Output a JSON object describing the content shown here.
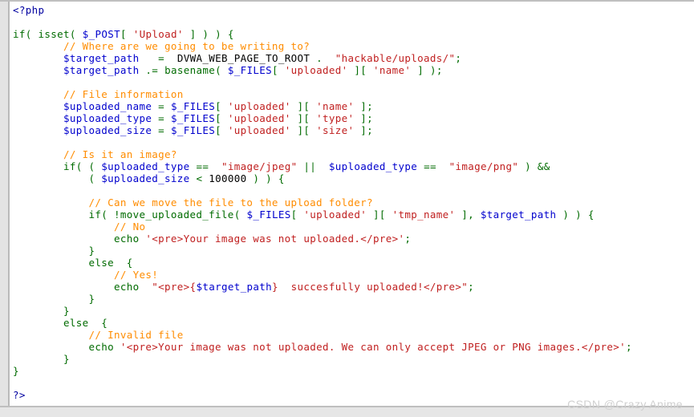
{
  "viewer": {
    "name": "php-source-code-viewer",
    "background": "#ffffff",
    "gutter_color": "#e3e3e3",
    "border_color": "#bfbfbf"
  },
  "syntax_colors": {
    "variable": "#0000cd",
    "keyword": "#006b00",
    "string": "#c02020",
    "comment": "#ff8c00",
    "plain": "#000000",
    "php_tag": "#0000a0"
  },
  "watermark": {
    "text": "CSDN @Crazy Anime",
    "color": "#d0d0d0"
  },
  "code": {
    "language": "php",
    "lines": [
      [
        {
          "t": "<?php",
          "c": "php"
        }
      ],
      [],
      [
        {
          "t": "if",
          "c": "kw"
        },
        {
          "t": "( ",
          "c": "kw"
        },
        {
          "t": "isset",
          "c": "kw"
        },
        {
          "t": "( ",
          "c": "kw"
        },
        {
          "t": "$_POST",
          "c": "var"
        },
        {
          "t": "[ ",
          "c": "kw"
        },
        {
          "t": "'Upload'",
          "c": "str"
        },
        {
          "t": " ] ) ) {",
          "c": "kw"
        }
      ],
      [
        {
          "t": "        ",
          "c": "plain"
        },
        {
          "t": "// Where are we going to be writing to?",
          "c": "com"
        }
      ],
      [
        {
          "t": "        ",
          "c": "plain"
        },
        {
          "t": "$target_path",
          "c": "var"
        },
        {
          "t": "   ",
          "c": "plain"
        },
        {
          "t": "=",
          "c": "kw"
        },
        {
          "t": "  ",
          "c": "plain"
        },
        {
          "t": "DVWA_WEB_PAGE_TO_ROOT",
          "c": "plain"
        },
        {
          "t": " ",
          "c": "plain"
        },
        {
          "t": ".",
          "c": "kw"
        },
        {
          "t": "  ",
          "c": "plain"
        },
        {
          "t": "\"hackable/uploads/\"",
          "c": "str"
        },
        {
          "t": ";",
          "c": "kw"
        }
      ],
      [
        {
          "t": "        ",
          "c": "plain"
        },
        {
          "t": "$target_path",
          "c": "var"
        },
        {
          "t": " ",
          "c": "plain"
        },
        {
          "t": ".=",
          "c": "kw"
        },
        {
          "t": " ",
          "c": "plain"
        },
        {
          "t": "basename",
          "c": "kw"
        },
        {
          "t": "( ",
          "c": "kw"
        },
        {
          "t": "$_FILES",
          "c": "var"
        },
        {
          "t": "[ ",
          "c": "kw"
        },
        {
          "t": "'uploaded'",
          "c": "str"
        },
        {
          "t": " ][ ",
          "c": "kw"
        },
        {
          "t": "'name'",
          "c": "str"
        },
        {
          "t": " ] );",
          "c": "kw"
        }
      ],
      [],
      [
        {
          "t": "        ",
          "c": "plain"
        },
        {
          "t": "// File information",
          "c": "com"
        }
      ],
      [
        {
          "t": "        ",
          "c": "plain"
        },
        {
          "t": "$uploaded_name",
          "c": "var"
        },
        {
          "t": " ",
          "c": "plain"
        },
        {
          "t": "=",
          "c": "kw"
        },
        {
          "t": " ",
          "c": "plain"
        },
        {
          "t": "$_FILES",
          "c": "var"
        },
        {
          "t": "[ ",
          "c": "kw"
        },
        {
          "t": "'uploaded'",
          "c": "str"
        },
        {
          "t": " ][ ",
          "c": "kw"
        },
        {
          "t": "'name'",
          "c": "str"
        },
        {
          "t": " ];",
          "c": "kw"
        }
      ],
      [
        {
          "t": "        ",
          "c": "plain"
        },
        {
          "t": "$uploaded_type",
          "c": "var"
        },
        {
          "t": " ",
          "c": "plain"
        },
        {
          "t": "=",
          "c": "kw"
        },
        {
          "t": " ",
          "c": "plain"
        },
        {
          "t": "$_FILES",
          "c": "var"
        },
        {
          "t": "[ ",
          "c": "kw"
        },
        {
          "t": "'uploaded'",
          "c": "str"
        },
        {
          "t": " ][ ",
          "c": "kw"
        },
        {
          "t": "'type'",
          "c": "str"
        },
        {
          "t": " ];",
          "c": "kw"
        }
      ],
      [
        {
          "t": "        ",
          "c": "plain"
        },
        {
          "t": "$uploaded_size",
          "c": "var"
        },
        {
          "t": " ",
          "c": "plain"
        },
        {
          "t": "=",
          "c": "kw"
        },
        {
          "t": " ",
          "c": "plain"
        },
        {
          "t": "$_FILES",
          "c": "var"
        },
        {
          "t": "[ ",
          "c": "kw"
        },
        {
          "t": "'uploaded'",
          "c": "str"
        },
        {
          "t": " ][ ",
          "c": "kw"
        },
        {
          "t": "'size'",
          "c": "str"
        },
        {
          "t": " ];",
          "c": "kw"
        }
      ],
      [],
      [
        {
          "t": "        ",
          "c": "plain"
        },
        {
          "t": "// Is it an image?",
          "c": "com"
        }
      ],
      [
        {
          "t": "        ",
          "c": "plain"
        },
        {
          "t": "if",
          "c": "kw"
        },
        {
          "t": "( ( ",
          "c": "kw"
        },
        {
          "t": "$uploaded_type",
          "c": "var"
        },
        {
          "t": " ",
          "c": "plain"
        },
        {
          "t": "==",
          "c": "kw"
        },
        {
          "t": "  ",
          "c": "plain"
        },
        {
          "t": "\"image/jpeg\"",
          "c": "str"
        },
        {
          "t": " ",
          "c": "plain"
        },
        {
          "t": "||",
          "c": "kw"
        },
        {
          "t": "  ",
          "c": "plain"
        },
        {
          "t": "$uploaded_type",
          "c": "var"
        },
        {
          "t": " ",
          "c": "plain"
        },
        {
          "t": "==",
          "c": "kw"
        },
        {
          "t": "  ",
          "c": "plain"
        },
        {
          "t": "\"image/png\"",
          "c": "str"
        },
        {
          "t": " ) ",
          "c": "kw"
        },
        {
          "t": "&&",
          "c": "kw"
        }
      ],
      [
        {
          "t": "            ",
          "c": "plain"
        },
        {
          "t": "( ",
          "c": "kw"
        },
        {
          "t": "$uploaded_size",
          "c": "var"
        },
        {
          "t": " ",
          "c": "plain"
        },
        {
          "t": "<",
          "c": "kw"
        },
        {
          "t": " ",
          "c": "plain"
        },
        {
          "t": "100000",
          "c": "plain"
        },
        {
          "t": " ) ) {",
          "c": "kw"
        }
      ],
      [],
      [
        {
          "t": "            ",
          "c": "plain"
        },
        {
          "t": "// Can we move the file to the upload folder?",
          "c": "com"
        }
      ],
      [
        {
          "t": "            ",
          "c": "plain"
        },
        {
          "t": "if",
          "c": "kw"
        },
        {
          "t": "( ",
          "c": "kw"
        },
        {
          "t": "!move_uploaded_file",
          "c": "kw"
        },
        {
          "t": "( ",
          "c": "kw"
        },
        {
          "t": "$_FILES",
          "c": "var"
        },
        {
          "t": "[ ",
          "c": "kw"
        },
        {
          "t": "'uploaded'",
          "c": "str"
        },
        {
          "t": " ][ ",
          "c": "kw"
        },
        {
          "t": "'tmp_name'",
          "c": "str"
        },
        {
          "t": " ], ",
          "c": "kw"
        },
        {
          "t": "$target_path",
          "c": "var"
        },
        {
          "t": " ) ) {",
          "c": "kw"
        }
      ],
      [
        {
          "t": "                ",
          "c": "plain"
        },
        {
          "t": "// No",
          "c": "com"
        }
      ],
      [
        {
          "t": "                ",
          "c": "plain"
        },
        {
          "t": "echo",
          "c": "kw"
        },
        {
          "t": " ",
          "c": "plain"
        },
        {
          "t": "'<pre>Your image was not uploaded.</pre>'",
          "c": "str"
        },
        {
          "t": ";",
          "c": "kw"
        }
      ],
      [
        {
          "t": "            ",
          "c": "plain"
        },
        {
          "t": "}",
          "c": "kw"
        }
      ],
      [
        {
          "t": "            ",
          "c": "plain"
        },
        {
          "t": "else",
          "c": "kw"
        },
        {
          "t": "  {",
          "c": "kw"
        }
      ],
      [
        {
          "t": "                ",
          "c": "plain"
        },
        {
          "t": "// Yes!",
          "c": "com"
        }
      ],
      [
        {
          "t": "                ",
          "c": "plain"
        },
        {
          "t": "echo",
          "c": "kw"
        },
        {
          "t": "  ",
          "c": "plain"
        },
        {
          "t": "\"<pre>{",
          "c": "str"
        },
        {
          "t": "$target_path",
          "c": "var"
        },
        {
          "t": "}  succesfully uploaded!</pre>\"",
          "c": "str"
        },
        {
          "t": ";",
          "c": "kw"
        }
      ],
      [
        {
          "t": "            ",
          "c": "plain"
        },
        {
          "t": "}",
          "c": "kw"
        }
      ],
      [
        {
          "t": "        ",
          "c": "plain"
        },
        {
          "t": "}",
          "c": "kw"
        }
      ],
      [
        {
          "t": "        ",
          "c": "plain"
        },
        {
          "t": "else",
          "c": "kw"
        },
        {
          "t": "  {",
          "c": "kw"
        }
      ],
      [
        {
          "t": "            ",
          "c": "plain"
        },
        {
          "t": "// Invalid file",
          "c": "com"
        }
      ],
      [
        {
          "t": "            ",
          "c": "plain"
        },
        {
          "t": "echo",
          "c": "kw"
        },
        {
          "t": " ",
          "c": "plain"
        },
        {
          "t": "'<pre>Your image was not uploaded. We can only accept JPEG or PNG images.</pre>'",
          "c": "str"
        },
        {
          "t": ";",
          "c": "kw"
        }
      ],
      [
        {
          "t": "        ",
          "c": "plain"
        },
        {
          "t": "}",
          "c": "kw"
        }
      ],
      [
        {
          "t": "}",
          "c": "kw"
        }
      ],
      [],
      [
        {
          "t": "?>",
          "c": "php"
        }
      ]
    ]
  }
}
